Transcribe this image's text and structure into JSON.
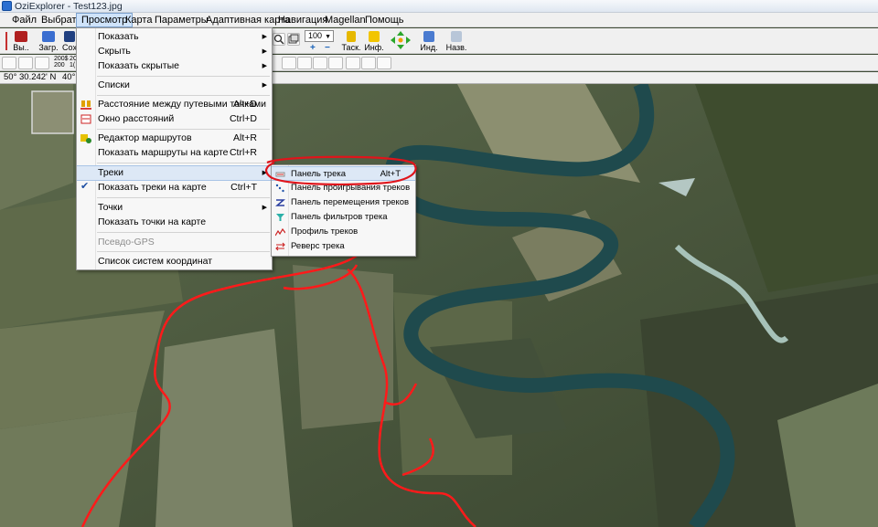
{
  "window": {
    "title": "OziExplorer - Test123.jpg"
  },
  "menubar": [
    {
      "label": "Файл",
      "active": false
    },
    {
      "label": "Выбрать",
      "active": false
    },
    {
      "label": "Просмотр",
      "active": true
    },
    {
      "label": "Карта",
      "active": false
    },
    {
      "label": "Параметры",
      "active": false
    },
    {
      "label": "Адаптивная карта",
      "active": false
    },
    {
      "label": "Навигация",
      "active": false
    },
    {
      "label": "Magellan",
      "active": false
    },
    {
      "label": "Помощь",
      "active": false
    }
  ],
  "toolbar": {
    "buttons": [
      {
        "label": "Вы..",
        "icon": "exit-icon"
      },
      {
        "label": "Загр.",
        "icon": "load-icon"
      },
      {
        "label": "Сох",
        "icon": "save-icon"
      },
      {
        "label": "Таск.",
        "icon": "lock-icon"
      },
      {
        "label": "Инф.",
        "icon": "info-icon"
      },
      {
        "label": "Инд.",
        "icon": "index-icon"
      },
      {
        "label": "Назв.",
        "icon": "name-icon"
      }
    ],
    "zoom_value": "100",
    "scale_labels": [
      "200$",
      "200",
      "2C",
      "1("
    ]
  },
  "coords": {
    "lat": "50° 30.242' N",
    "lon": "40°"
  },
  "view_menu": {
    "items": [
      {
        "label": "Показать",
        "shortcut": "",
        "submenu": true
      },
      {
        "label": "Скрыть",
        "shortcut": "",
        "submenu": true
      },
      {
        "label": "Показать скрытые",
        "shortcut": "",
        "submenu": true
      },
      {
        "label": "Списки",
        "shortcut": "",
        "submenu": true
      },
      {
        "label": "Расстояние между путевыми точками",
        "shortcut": "Alt+D",
        "icon": "waypoint-distance-icon"
      },
      {
        "label": "Окно расстояний",
        "shortcut": "Ctrl+D",
        "icon": "distance-window-icon"
      },
      {
        "label": "Редактор маршрутов",
        "shortcut": "Alt+R",
        "icon": "route-editor-icon"
      },
      {
        "label": "Показать маршруты на карте",
        "shortcut": "Ctrl+R"
      },
      {
        "label": "Треки",
        "shortcut": "",
        "submenu": true,
        "highlighted": true
      },
      {
        "label": "Показать треки на карте",
        "shortcut": "Ctrl+T",
        "checked": true
      },
      {
        "label": "Точки",
        "shortcut": "",
        "submenu": true
      },
      {
        "label": "Показать точки на карте",
        "shortcut": ""
      },
      {
        "label": "Псевдо-GPS",
        "shortcut": "",
        "disabled": true
      },
      {
        "label": "Список систем координат",
        "shortcut": ""
      }
    ]
  },
  "tracks_submenu": {
    "items": [
      {
        "label": "Панель трека",
        "shortcut": "Alt+T",
        "icon": "track-panel-icon",
        "highlighted": true
      },
      {
        "label": "Панель проигрывания треков",
        "shortcut": "",
        "icon": "track-replay-icon"
      },
      {
        "label": "Панель перемещения треков",
        "shortcut": "",
        "icon": "track-move-icon"
      },
      {
        "label": "Панель фильтров трека",
        "shortcut": "",
        "icon": "track-filter-icon"
      },
      {
        "label": "Профиль треков",
        "shortcut": "",
        "icon": "track-profile-icon"
      },
      {
        "label": "Реверс трека",
        "shortcut": "",
        "icon": "track-reverse-icon"
      }
    ]
  },
  "colors": {
    "menu_highlight": "#dde8f6",
    "annotation_red": "#e0141b",
    "track_red": "#ff1a1a",
    "river": "#1f4a4d"
  }
}
